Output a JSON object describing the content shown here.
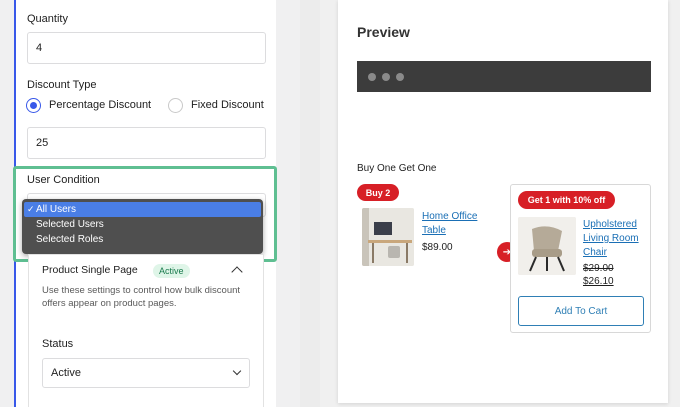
{
  "settings": {
    "quantity_label": "Quantity",
    "quantity_value": "4",
    "discount_type_label": "Discount Type",
    "discount_options": [
      "Percentage Discount",
      "Fixed Discount"
    ],
    "discount_selected": "Percentage Discount",
    "discount_value": "25",
    "user_condition_label": "User Condition",
    "user_condition_options": [
      "All Users",
      "Selected Users",
      "Selected Roles"
    ],
    "user_condition_selected": "All Users",
    "product_page": {
      "title": "Product Single Page",
      "badge": "Active",
      "description": "Use these settings to control how bulk discount offers appear on product pages.",
      "status_label": "Status",
      "status_value": "Active"
    }
  },
  "preview": {
    "title": "Preview",
    "offer_title": "Buy One Get One",
    "buy_badge": "Buy 2",
    "get_badge": "Get 1 with 10% off",
    "product1": {
      "name_line1": "Home Office",
      "name_line2": "Table",
      "price": "$89.00"
    },
    "product2": {
      "name_line1": "Upholstered",
      "name_line2": "Living Room",
      "name_line3": "Chair",
      "old_price": "$29.00",
      "new_price": "$26.10"
    },
    "add_to_cart": "Add To Cart"
  },
  "colors": {
    "accent": "#3858e9",
    "highlight": "#5fbf92",
    "badge_red": "#d71f26",
    "link": "#1a6fb5"
  }
}
